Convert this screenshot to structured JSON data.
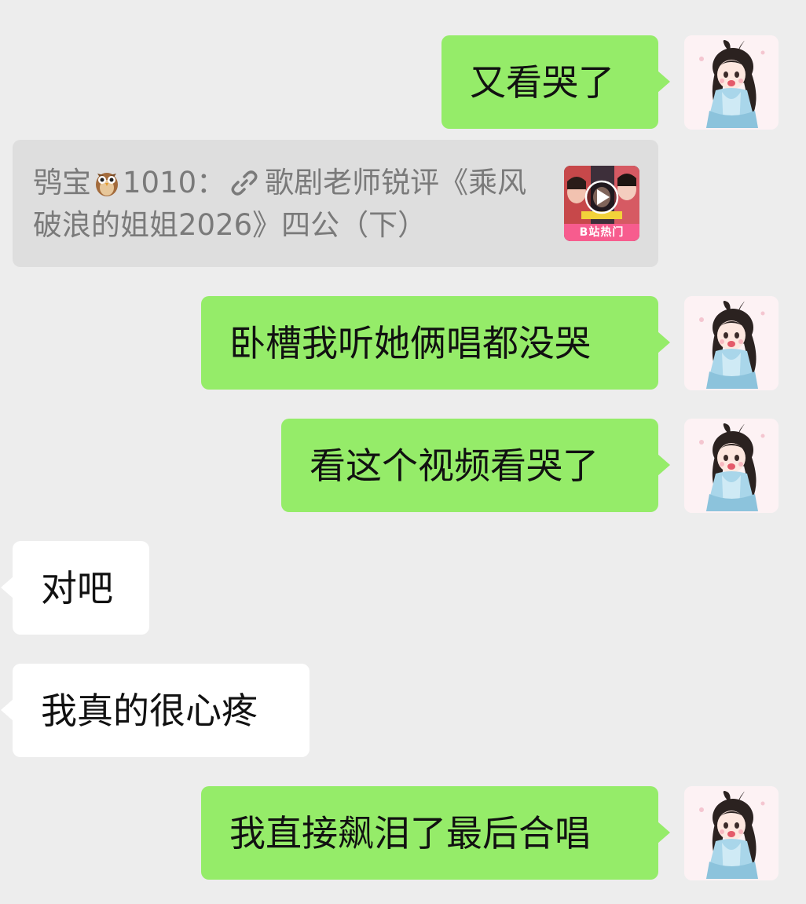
{
  "colors": {
    "background": "#ededed",
    "outgoing_bubble": "#95ec69",
    "incoming_bubble": "#ffffff",
    "quote_bubble": "#dedede",
    "quote_text": "#7a7a7a",
    "badge": "#f75c8e"
  },
  "messages": [
    {
      "side": "right",
      "text": "又看哭了"
    },
    {
      "type": "quote",
      "sender": "鸮宝",
      "sender_suffix": "1010：",
      "sender_emoji": "owl-icon",
      "link_icon": "link-icon",
      "text": "歌剧老师锐评《乘风破浪的姐姐2026》四公（下）",
      "thumbnail_badge": "B站热门"
    },
    {
      "side": "right",
      "text": "卧槽我听她俩唱都没哭"
    },
    {
      "side": "right",
      "text": "看这个视频看哭了"
    },
    {
      "side": "left",
      "text": "对吧"
    },
    {
      "side": "left",
      "text": "我真的很心疼"
    },
    {
      "side": "right",
      "text": "我直接飙泪了最后合唱"
    }
  ]
}
